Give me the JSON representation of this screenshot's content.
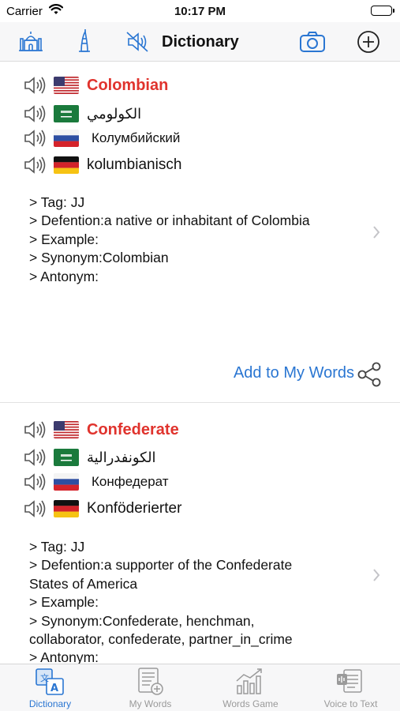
{
  "status": {
    "carrier": "Carrier",
    "time": "10:17 PM"
  },
  "nav": {
    "title": "Dictionary"
  },
  "entries": [
    {
      "en": "Colombian",
      "ar": "الكولومي",
      "ru": "Колумбийский",
      "de": "kolumbianisch",
      "details": [
        "> Tag: JJ",
        "> Defention:a native or inhabitant of Colombia",
        "> Example:",
        "> Synonym:Colombian",
        "> Antonym:"
      ],
      "add_label": "Add to My Words"
    },
    {
      "en": "Confederate",
      "ar": "الكونفدرالية",
      "ru": "Конфедерат",
      "de": "Konföderierter",
      "details": [
        "> Tag: JJ",
        "> Defention:a supporter of the Confederate",
        "States of America",
        "> Example:",
        "> Synonym:Confederate, henchman,",
        "collaborator, confederate, partner_in_crime",
        "> Antonym:"
      ]
    }
  ],
  "tabs": [
    {
      "label": "Dictionary",
      "active": true
    },
    {
      "label": "My Words",
      "active": false
    },
    {
      "label": "Words Game",
      "active": false
    },
    {
      "label": "Voice to Text",
      "active": false
    }
  ],
  "colors": {
    "accent": "#2a76d2",
    "headword": "#e0332d"
  }
}
